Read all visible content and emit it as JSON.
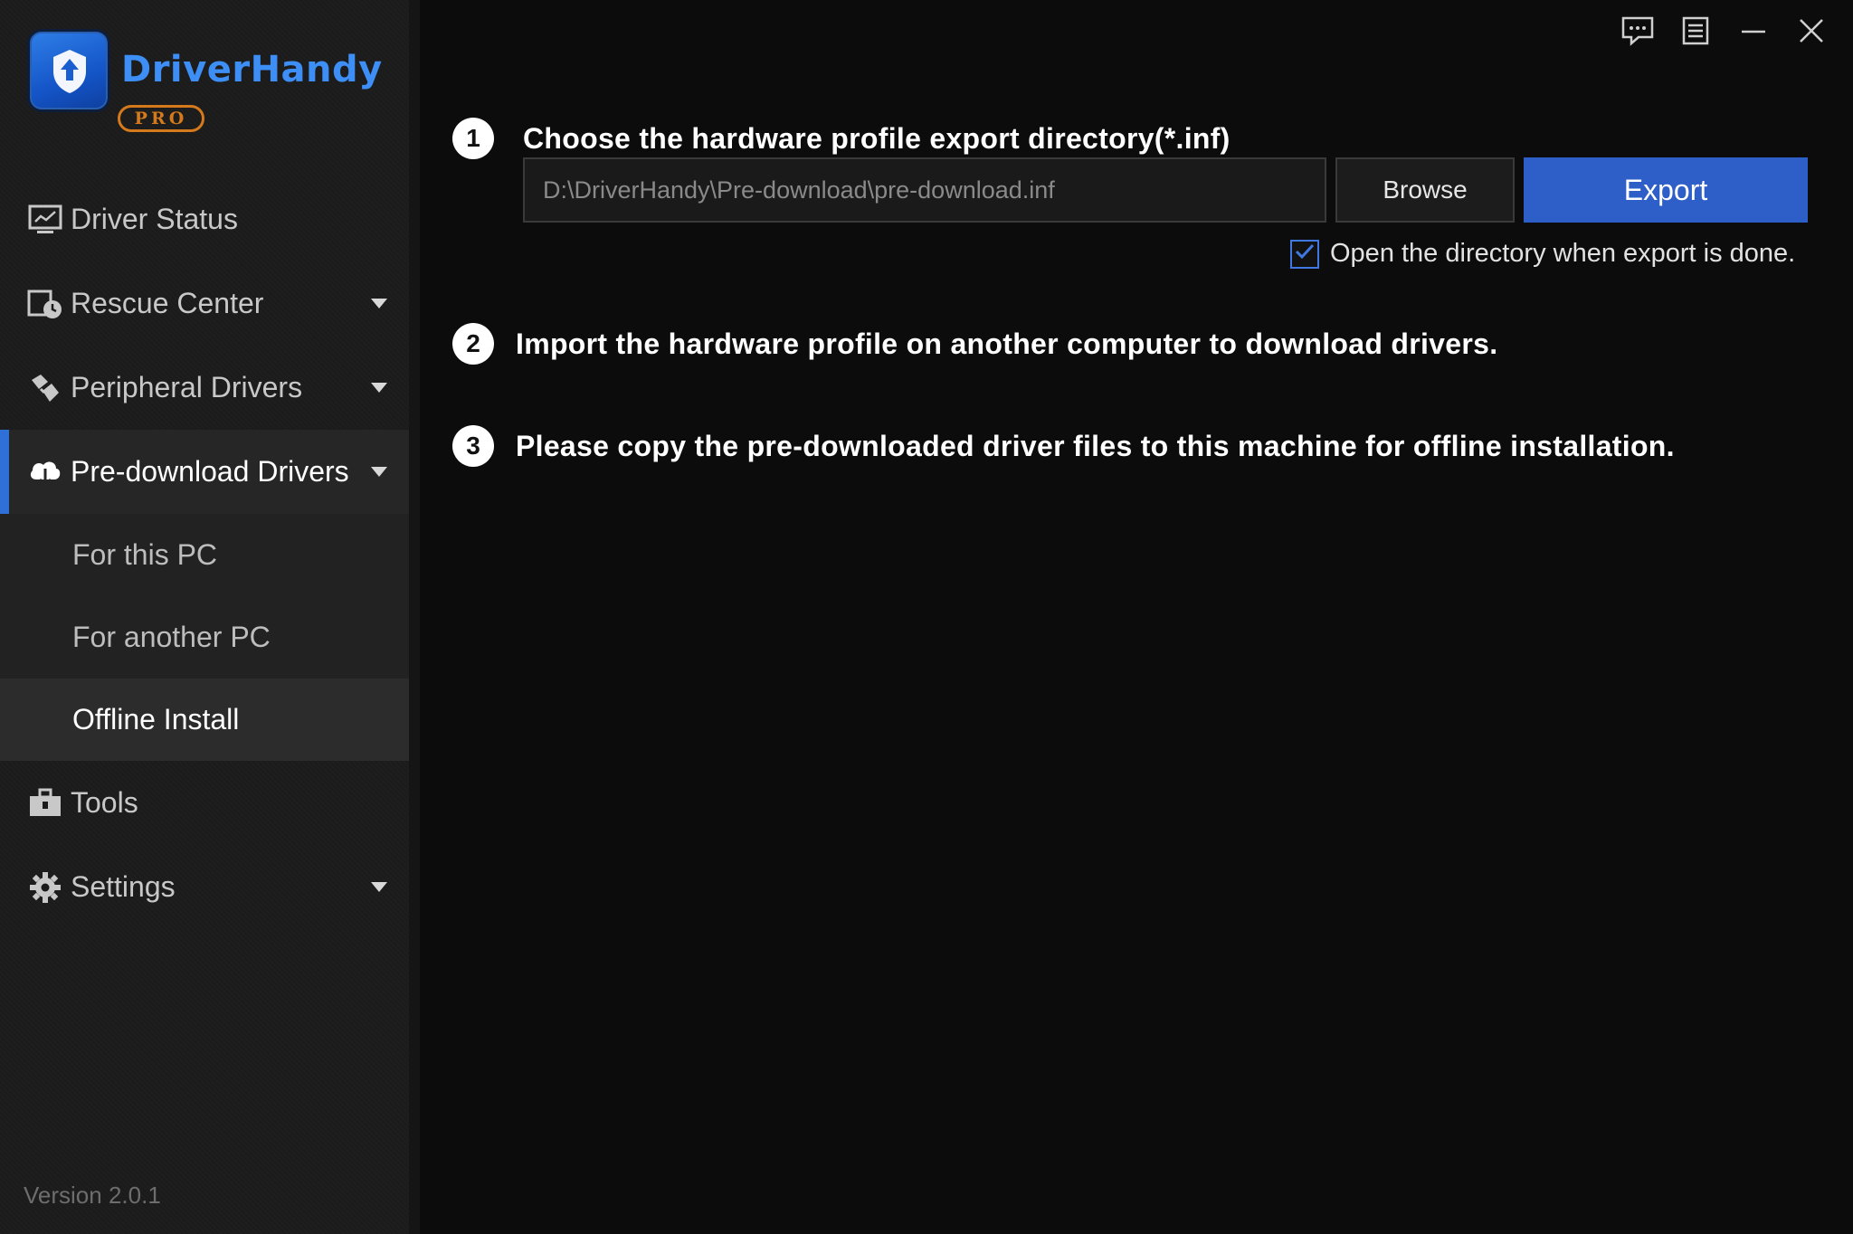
{
  "app": {
    "brand_name": "DriverHandy",
    "edition": "PRO",
    "version": "Version 2.0.1"
  },
  "sidebar": {
    "items": [
      {
        "label": "Driver Status",
        "icon": "monitor-icon",
        "expandable": false
      },
      {
        "label": "Rescue Center",
        "icon": "clock-restore-icon",
        "expandable": true
      },
      {
        "label": "Peripheral Drivers",
        "icon": "peripheral-icon",
        "expandable": true
      },
      {
        "label": "Pre-download Drivers",
        "icon": "cloud-download-icon",
        "expandable": true,
        "active": true
      },
      {
        "label": "Tools",
        "icon": "toolbox-icon",
        "expandable": false
      },
      {
        "label": "Settings",
        "icon": "gear-icon",
        "expandable": true
      }
    ],
    "subitems": [
      {
        "label": "For this PC"
      },
      {
        "label": "For another PC"
      },
      {
        "label": "Offline Install",
        "selected": true
      }
    ]
  },
  "window_controls": [
    "feedback-icon",
    "menu-icon",
    "minimize-icon",
    "close-icon"
  ],
  "main": {
    "step1": {
      "number": "1",
      "text": "Choose the hardware profile export directory(*.inf)",
      "path_value": "D:\\DriverHandy\\Pre-download\\pre-download.inf",
      "browse_label": "Browse",
      "export_label": "Export",
      "open_dir_label": "Open the directory when export is done.",
      "open_dir_checked": true
    },
    "step2": {
      "number": "2",
      "text": "Import the hardware profile on another computer to download drivers."
    },
    "step3": {
      "number": "3",
      "text": "Please copy the pre-downloaded driver files to this machine for offline installation."
    }
  },
  "colors": {
    "accent": "#2e5fc9",
    "brand": "#3d8ef5",
    "pro_badge": "#d47a1c",
    "background": "#0c0c0c",
    "sidebar": "#1b1b1b"
  }
}
